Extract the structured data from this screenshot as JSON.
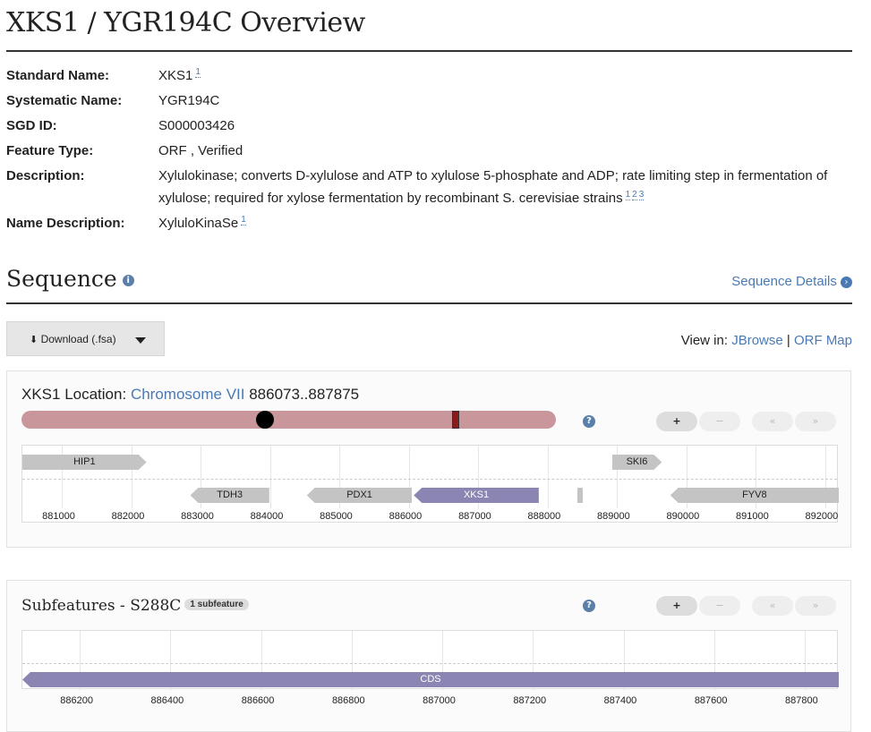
{
  "page": {
    "title": "XKS1 / YGR194C Overview"
  },
  "overview": {
    "standard_name": {
      "label": "Standard Name:",
      "value": "XKS1",
      "refs": "1"
    },
    "systematic_name": {
      "label": "Systematic Name:",
      "value": "YGR194C"
    },
    "sgd_id": {
      "label": "SGD ID:",
      "value": "S000003426"
    },
    "feature_type": {
      "label": "Feature Type:",
      "value": "ORF , Verified"
    },
    "description": {
      "label": "Description:",
      "value": "Xylulokinase; converts D-xylulose and ATP to xylulose 5-phosphate and ADP; rate limiting step in fermentation of xylulose; required for xylose fermentation by recombinant S. cerevisiae strains",
      "refs": [
        "1",
        "2",
        "3"
      ]
    },
    "name_description": {
      "label": "Name Description:",
      "value": "XyluloKinaSe",
      "refs": "1"
    }
  },
  "sequence": {
    "title": "Sequence",
    "details_link": "Sequence Details",
    "download_label": "Download (.fsa)",
    "view_in_label": "View in:",
    "jbrowse": "JBrowse",
    "separator": "|",
    "orf_map": "ORF Map"
  },
  "location": {
    "title_prefix": "XKS1 Location:",
    "chromosome": "Chromosome VII",
    "range": "886073..887875",
    "btn_plus": "+",
    "btn_minus": "−",
    "btn_prev": "«",
    "btn_next": "»",
    "genes": [
      {
        "name": "HIP1",
        "start": 880420,
        "end": 882220,
        "strand": "+",
        "highlight": false
      },
      {
        "name": "TDH3",
        "start": 882850,
        "end": 883990,
        "strand": "-",
        "highlight": false
      },
      {
        "name": "PDX1",
        "start": 884530,
        "end": 886050,
        "strand": "-",
        "highlight": false
      },
      {
        "name": "XKS1",
        "start": 886073,
        "end": 887875,
        "strand": "-",
        "highlight": true
      },
      {
        "name": "",
        "start": 888430,
        "end": 888510,
        "strand": "0",
        "highlight": false
      },
      {
        "name": "SKI6",
        "start": 888930,
        "end": 889650,
        "strand": "+",
        "highlight": false
      },
      {
        "name": "FYV8",
        "start": 889770,
        "end": 892200,
        "strand": "-",
        "highlight": false
      }
    ],
    "axis_ticks": [
      "881000",
      "882000",
      "883000",
      "884000",
      "885000",
      "886000",
      "887000",
      "888000",
      "889000",
      "890000",
      "891000",
      "892000"
    ]
  },
  "subfeatures": {
    "title": "Subfeatures - S288C",
    "badge": "1 subfeature",
    "btn_plus": "+",
    "btn_minus": "−",
    "btn_prev": "«",
    "btn_next": "»",
    "cds_label": "CDS",
    "axis_ticks": [
      "886200",
      "886400",
      "886600",
      "886800",
      "887000",
      "887200",
      "887400",
      "887600",
      "887800"
    ]
  },
  "colors": {
    "highlight_gene": "#8b85b3",
    "gene": "#c4c4c4",
    "chromosome": "#c9969b",
    "marker": "#8b1a1a"
  }
}
